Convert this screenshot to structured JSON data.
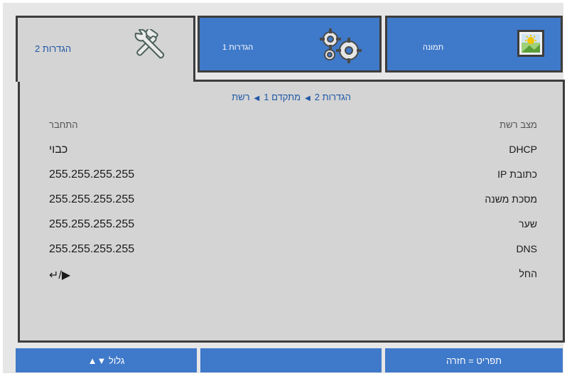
{
  "tabs": [
    {
      "label": "הגדרות 2",
      "icon": "tools-icon",
      "active": true
    },
    {
      "label": "הגדרות 1",
      "icon": "gears-icon",
      "active": false
    },
    {
      "label": "תמונה",
      "icon": "picture-icon",
      "active": false
    }
  ],
  "breadcrumb": [
    "הגדרות 2",
    "מתקדם 1",
    "רשת"
  ],
  "breadcrumb_separator": "◀",
  "header": {
    "left": "התחבר",
    "right": "מצב רשת"
  },
  "rows": [
    {
      "label": "DHCP",
      "value": "כבוי"
    },
    {
      "label": "כתובת IP",
      "value": "255.255.255.255"
    },
    {
      "label": "מסכת משנה",
      "value": "255.255.255.255"
    },
    {
      "label": "שער",
      "value": "255.255.255.255"
    },
    {
      "label": "DNS",
      "value": "255.255.255.255"
    },
    {
      "label": "החל",
      "value": "↵/▶"
    }
  ],
  "bottom": {
    "scroll": "גלול ▼▲",
    "middle": "",
    "menu": "תפריט = חזרה"
  },
  "colors": {
    "accent": "#3f79c9",
    "text_blue": "#1f57a7",
    "panel": "#d4d4d4",
    "border": "#3d3d3d"
  }
}
